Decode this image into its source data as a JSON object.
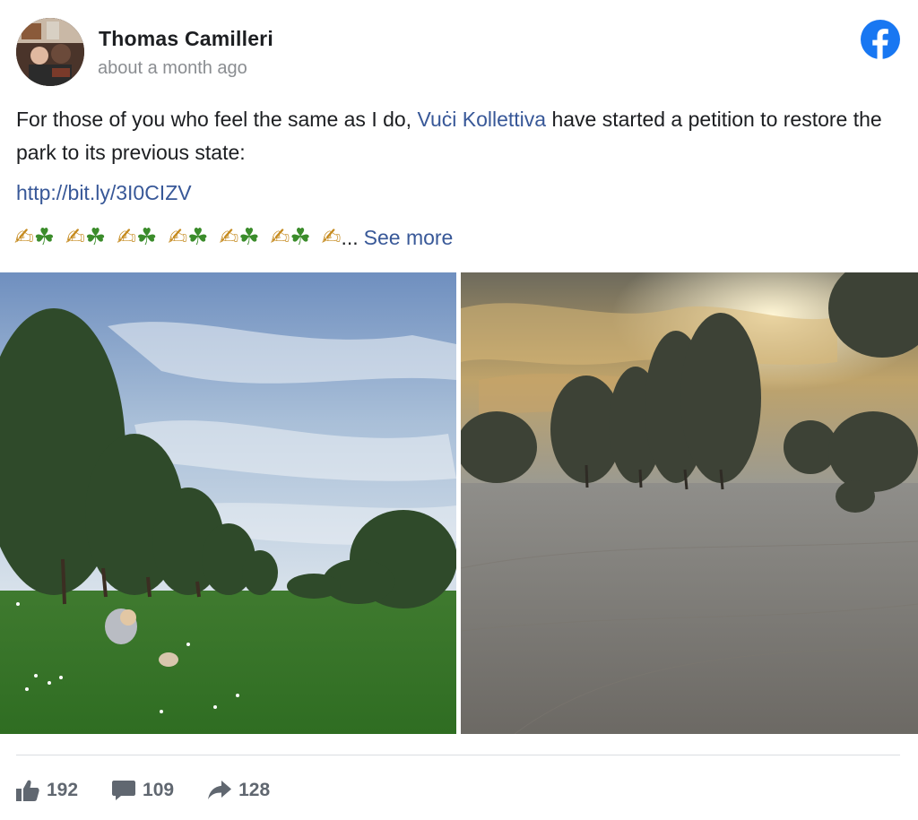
{
  "post": {
    "author": "Thomas Camilleri",
    "timestamp": "about a month ago",
    "text_before": "For those of you who feel the same as I do, ",
    "mention": "Vuċi Kollettiva",
    "text_after": " have started a petition to restore the park to its previous state:",
    "url": "http://bit.ly/3I0CIZV",
    "emoji_sequence": [
      "✍",
      "☘",
      "✍",
      "☘",
      "✍",
      "☘",
      "✍",
      "☘",
      "✍",
      "☘",
      "✍",
      "☘",
      "✍"
    ],
    "ellipsis": "...",
    "see_more": "See more"
  },
  "icons": {
    "brand": "facebook-icon",
    "like": "thumbs-up-icon",
    "comment": "comment-icon",
    "share": "share-arrow-icon"
  },
  "stats": {
    "likes": "192",
    "comments": "109",
    "shares": "128"
  },
  "colors": {
    "facebook_blue": "#1877f2",
    "link_blue": "#385898",
    "muted_gray": "#8a8d91",
    "stat_gray": "#606770"
  }
}
